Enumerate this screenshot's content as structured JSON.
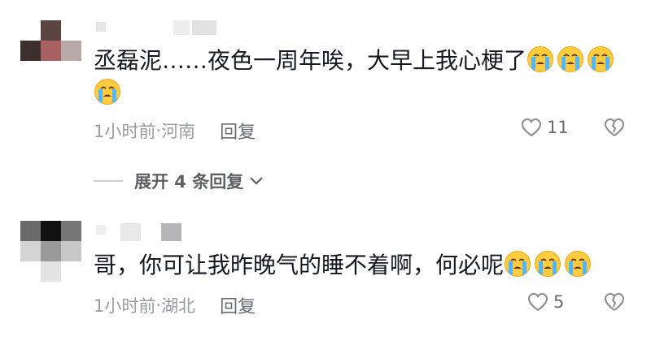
{
  "comments": [
    {
      "text": "丞磊泥……夜色一周年唉，大早上我心梗了",
      "emoji_count": 4,
      "emoji": "crying-face",
      "time": "1小时前",
      "location": "河南",
      "reply_label": "回复",
      "likes": "11"
    },
    {
      "text": "哥，你可让我昨晚气的睡不着啊，何必呢",
      "emoji_count": 3,
      "emoji": "crying-face",
      "time": "1小时前",
      "location": "湖北",
      "reply_label": "回复",
      "likes": "5"
    }
  ],
  "expand_replies": {
    "label": "展开 4 条回复"
  },
  "colors": {
    "text": "#161823",
    "meta": "#9a9ba0",
    "action": "#6b6c72"
  }
}
